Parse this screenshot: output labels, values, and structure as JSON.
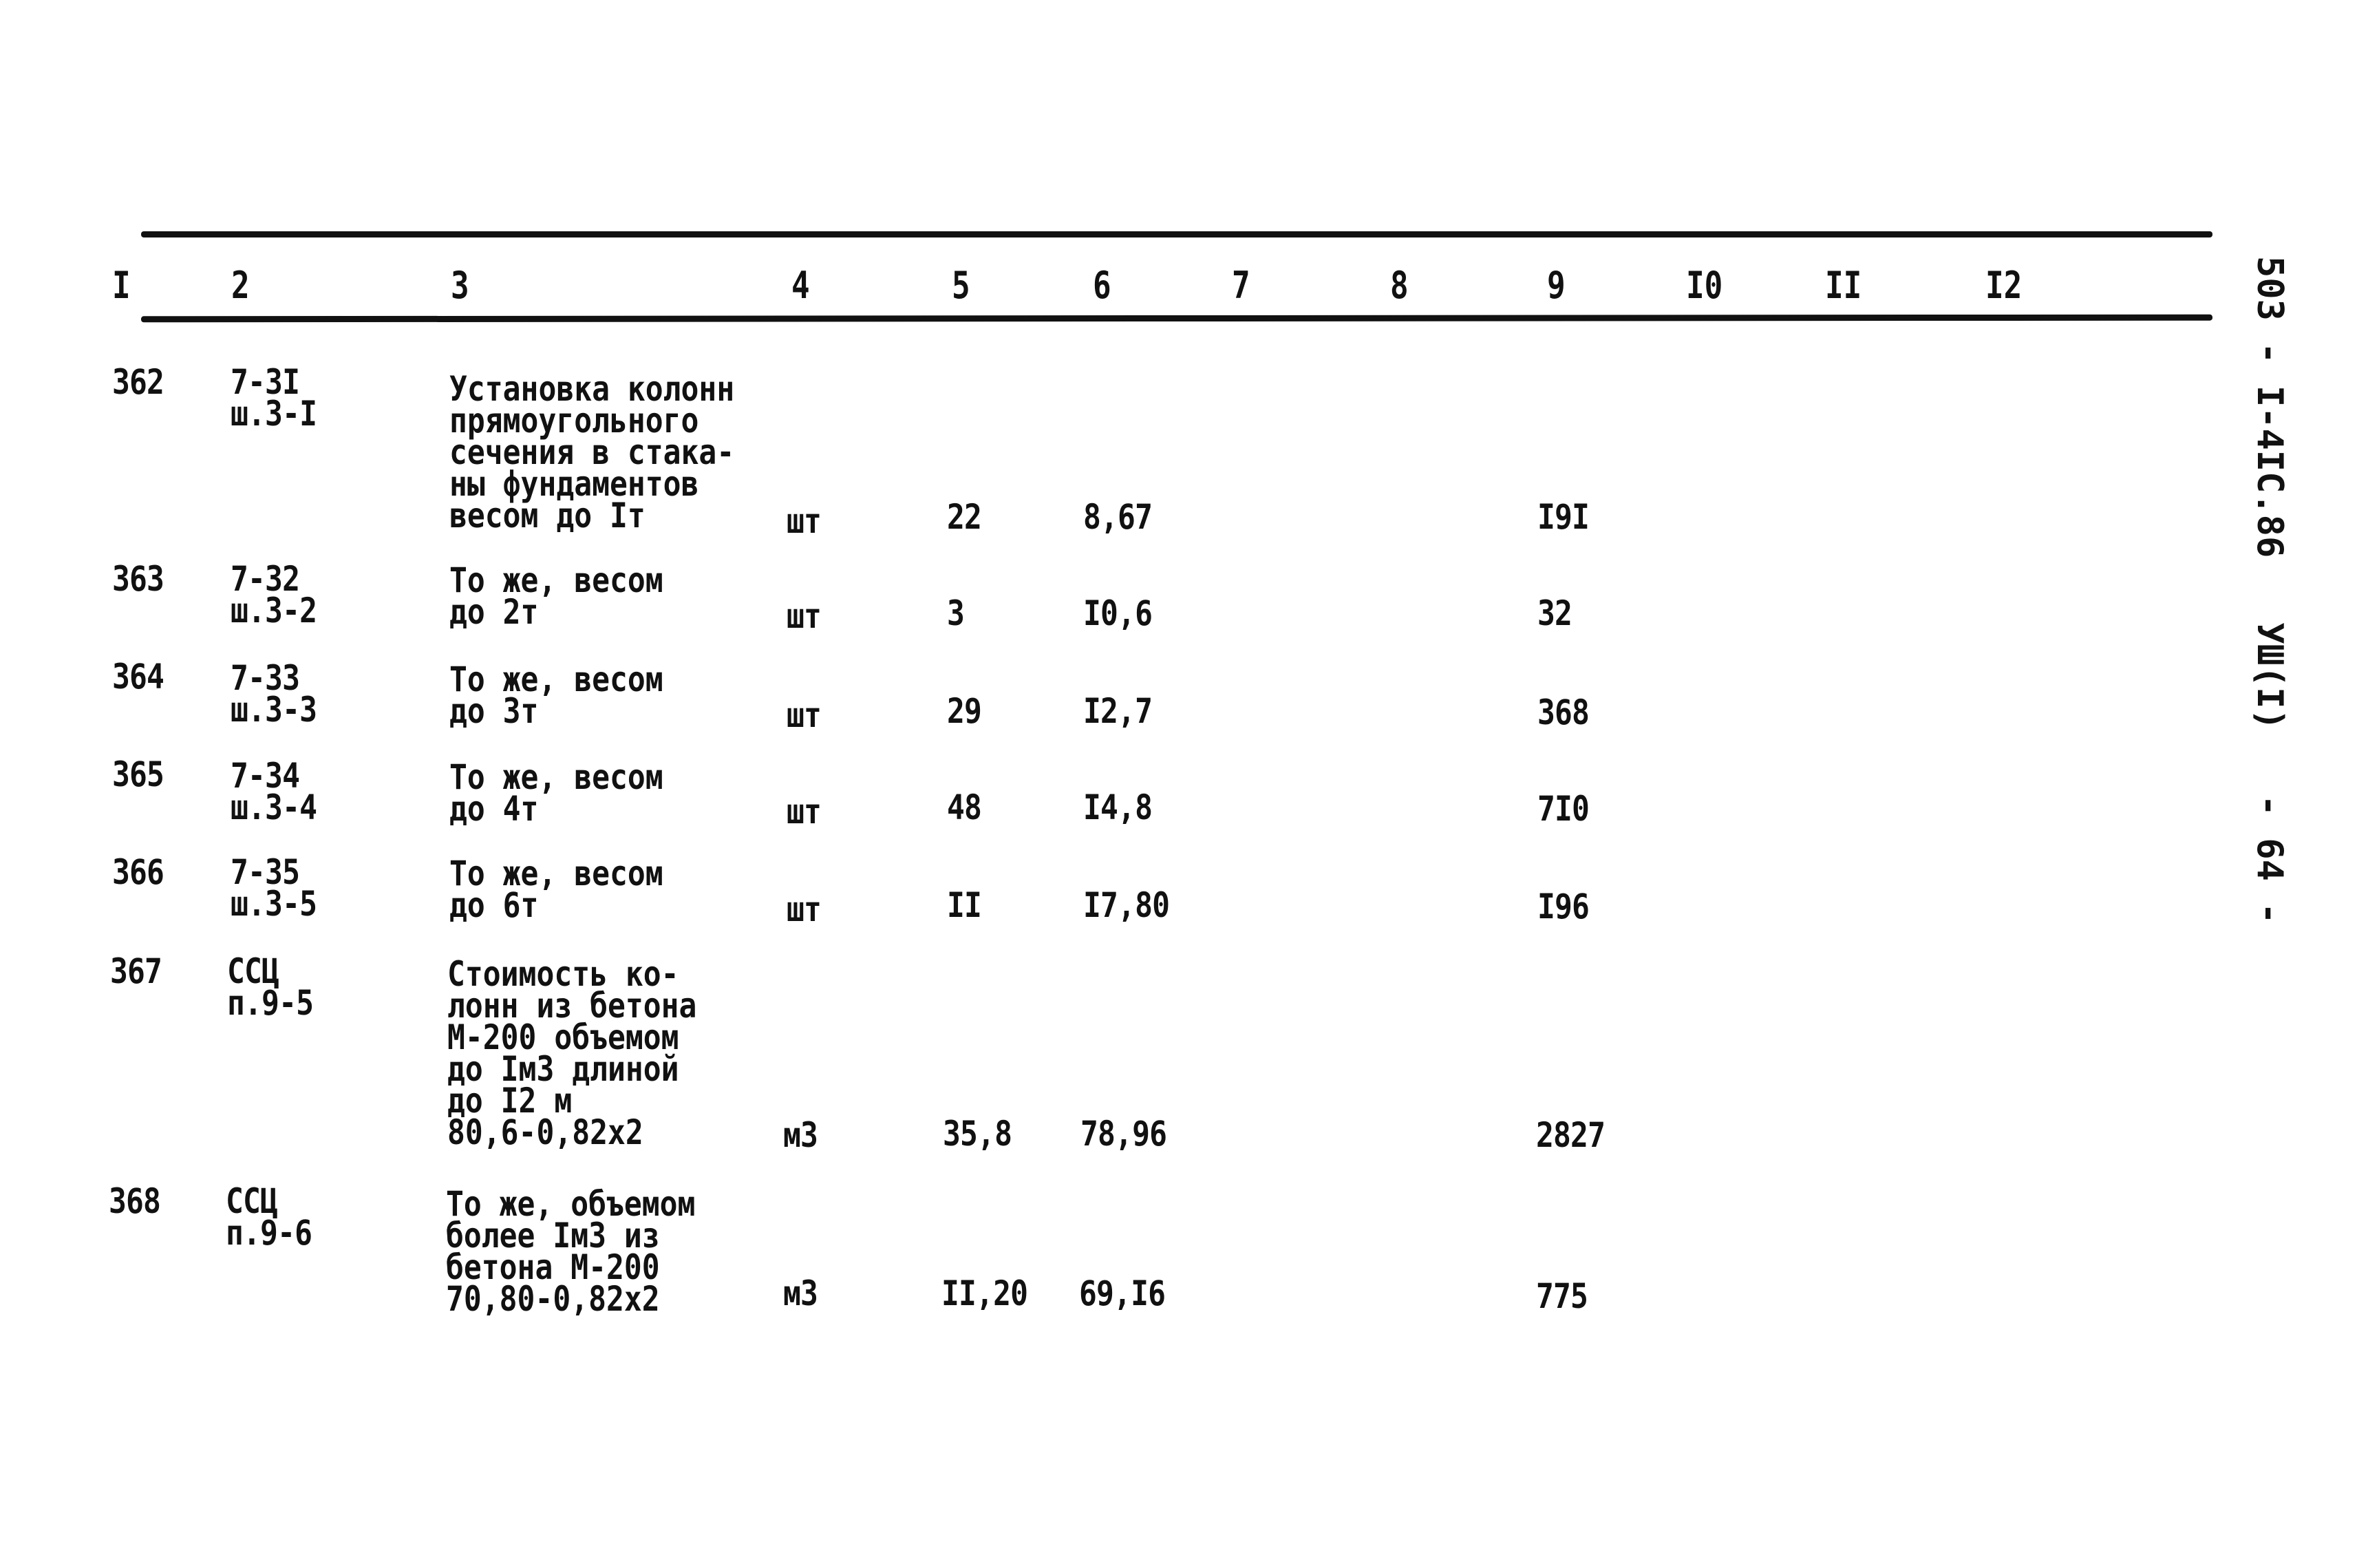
{
  "side_label": "503 - I-4IС.86   УШ(I)   - 64 -",
  "header": [
    "I",
    "2",
    "3",
    "4",
    "5",
    "6",
    "7",
    "8",
    "9",
    "I0",
    "II",
    "I2"
  ],
  "rows": [
    {
      "n": "362",
      "code": "7-3I\nш.3-I",
      "desc": "Установка колонн\nпрямоугольного\nсечения в стака-\nны фундаментов\nвесом до Iт",
      "unit": "шт",
      "qty": "22",
      "price": "8,67",
      "total": "I9I"
    },
    {
      "n": "363",
      "code": "7-32\nш.3-2",
      "desc": "То же, весом\nдо 2т",
      "unit": "шт",
      "qty": "3",
      "price": "I0,6",
      "total": "32"
    },
    {
      "n": "364",
      "code": "7-33\nш.3-3",
      "desc": "То же, весом\nдо 3т",
      "unit": "шт",
      "qty": "29",
      "price": "I2,7",
      "total": "368"
    },
    {
      "n": "365",
      "code": "7-34\nш.3-4",
      "desc": "То же, весом\nдо 4т",
      "unit": "шт",
      "qty": "48",
      "price": "I4,8",
      "total": "7I0"
    },
    {
      "n": "366",
      "code": "7-35\nш.3-5",
      "desc": "То же, весом\nдо 6т",
      "unit": "шт",
      "qty": "II",
      "price": "I7,80",
      "total": "I96"
    },
    {
      "n": "367",
      "code": "ССЦ\nп.9-5",
      "desc": "Стоимость ко-\nлонн из бетона\nМ-200 объемом\nдо Iм3 длиной\nдо I2 м\n80,6-0,82х2",
      "unit": "м3",
      "qty": "35,8",
      "price": "78,96",
      "total": "2827"
    },
    {
      "n": "368",
      "code": "ССЦ\nп.9-6",
      "desc": "То же, объемом\nболее Iм3 из\nбетона М-200\n70,80-0,82х2",
      "unit": "м3",
      "qty": "II,20",
      "price": "69,I6",
      "total": "775"
    }
  ]
}
